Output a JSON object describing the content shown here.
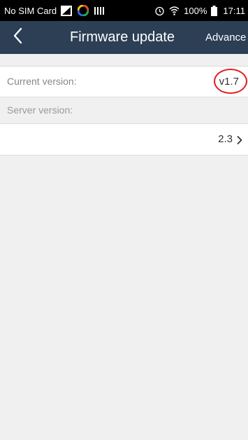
{
  "status_bar": {
    "carrier": "No SIM Card",
    "battery_percent": "100%",
    "time": "17:11",
    "icons": [
      "no-sim-icon",
      "sync-icon",
      "signal-bars-icon",
      "alarm-icon",
      "wifi-icon",
      "battery-icon"
    ]
  },
  "app_bar": {
    "title": "Firmware update",
    "advanced_label": "Advance",
    "back_icon": "chevron-left-icon",
    "background_color": "#2c3f55"
  },
  "current_version": {
    "label": "Current version:",
    "value": "v1.7",
    "highlight_color": "#e02020"
  },
  "server_version": {
    "label": "Server version:",
    "value": "2.3",
    "chevron_icon": "chevron-right-icon"
  }
}
